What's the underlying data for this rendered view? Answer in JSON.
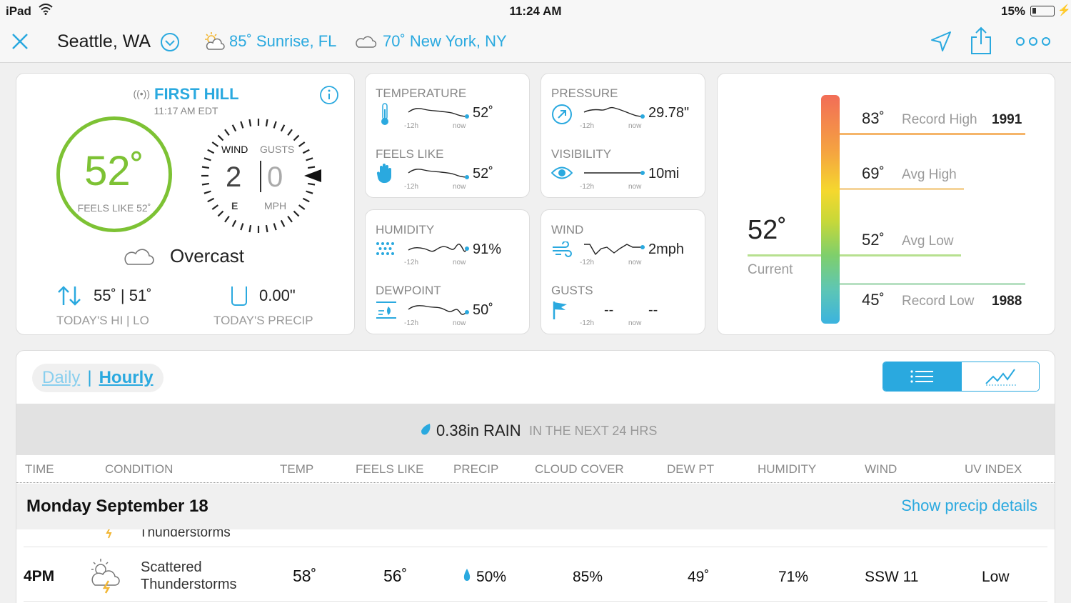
{
  "status": {
    "device": "iPad",
    "time": "11:24 AM",
    "battery": "15%"
  },
  "nav": {
    "city": "Seattle, WA",
    "loc2": "85˚ Sunrise, FL",
    "loc3": "70˚ New York, NY"
  },
  "current": {
    "station": "FIRST HILL",
    "station_time": "11:17 AM EDT",
    "temp": "52˚",
    "feels_like": "FEELS LIKE 52˚",
    "wind_label": "WIND",
    "gusts_label": "GUSTS",
    "wind_value": "2",
    "gusts_value": "0",
    "wind_dir": "E",
    "wind_unit": "MPH",
    "condition": "Overcast",
    "hilo": "55˚ | 51˚",
    "hilo_label": "TODAY'S HI | LO",
    "precip": "0.00\"",
    "precip_label": "TODAY'S PRECIP"
  },
  "metrics": {
    "temperature": {
      "label": "TEMPERATURE",
      "value": "52˚"
    },
    "feels_like": {
      "label": "FEELS LIKE",
      "value": "52˚"
    },
    "pressure": {
      "label": "PRESSURE",
      "value": "29.78\""
    },
    "visibility": {
      "label": "VISIBILITY",
      "value": "10mi"
    },
    "humidity": {
      "label": "HUMIDITY",
      "value": "91%"
    },
    "dewpoint": {
      "label": "DEWPOINT",
      "value": "50˚"
    },
    "wind": {
      "label": "WIND",
      "value": "2mph"
    },
    "gusts": {
      "label": "GUSTS",
      "value": "--",
      "value2": "--"
    },
    "tick_start": "-12h",
    "tick_end": "now"
  },
  "range": {
    "current": "52˚",
    "current_label": "Current",
    "record_high": {
      "value": "83˚",
      "label": "Record High",
      "year": "1991"
    },
    "avg_high": {
      "value": "69˚",
      "label": "Avg High"
    },
    "avg_low": {
      "value": "52˚",
      "label": "Avg Low"
    },
    "record_low": {
      "value": "45˚",
      "label": "Record Low",
      "year": "1988"
    }
  },
  "forecast": {
    "tab_daily": "Daily",
    "tab_hourly": "Hourly",
    "rain_amount": "0.38in RAIN",
    "rain_window": "IN THE NEXT 24 HRS",
    "columns": [
      "TIME",
      "CONDITION",
      "TEMP",
      "FEELS LIKE",
      "PRECIP",
      "CLOUD COVER",
      "DEW PT",
      "HUMIDITY",
      "WIND",
      "UV INDEX"
    ],
    "day": "Monday September 18",
    "show_precip": "Show precip details",
    "ghost_condition": "Thunderstorms",
    "rows": [
      {
        "time": "4PM",
        "cond1": "Scattered",
        "cond2": "Thunderstorms",
        "temp": "58˚",
        "feels": "56˚",
        "precip": "50%",
        "cloud": "85%",
        "dew": "49˚",
        "humidity": "71%",
        "wind": "SSW 11",
        "uv": "Low"
      }
    ]
  },
  "colors": {
    "accent": "#2aa9df",
    "temp_ring": "#7dc234"
  }
}
